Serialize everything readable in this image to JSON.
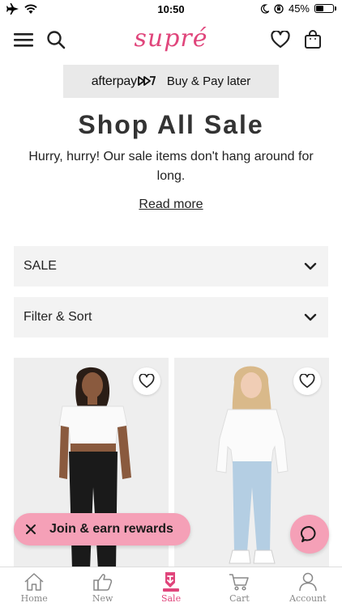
{
  "status_bar": {
    "time": "10:50",
    "battery_percent": "45%",
    "battery_level": 0.45
  },
  "header": {
    "logo_text": "supré",
    "menu_icon": "hamburger-menu-icon",
    "search_icon": "search-icon",
    "wishlist_icon": "heart-icon",
    "bag_icon": "shopping-bag-icon"
  },
  "afterpay": {
    "logo_text": "afterpay",
    "text": "Buy & Pay later"
  },
  "page": {
    "title": "Shop All Sale",
    "subtitle": "Hurry, hurry! Our sale items don't hang around for long.",
    "read_more": "Read more"
  },
  "filters": {
    "category": "SALE",
    "filter_sort": "Filter & Sort"
  },
  "rewards": {
    "label": "Join & earn rewards"
  },
  "tabs": [
    {
      "label": "Home",
      "icon": "home-icon"
    },
    {
      "label": "New",
      "icon": "thumbs-up-icon"
    },
    {
      "label": "Sale",
      "icon": "sale-tag-icon"
    },
    {
      "label": "Cart",
      "icon": "cart-icon"
    },
    {
      "label": "Account",
      "icon": "account-icon"
    }
  ],
  "colors": {
    "brand_pink": "#e0457b",
    "rewards_pink": "#f5a0b7",
    "panel_grey": "#f3f3f3"
  }
}
